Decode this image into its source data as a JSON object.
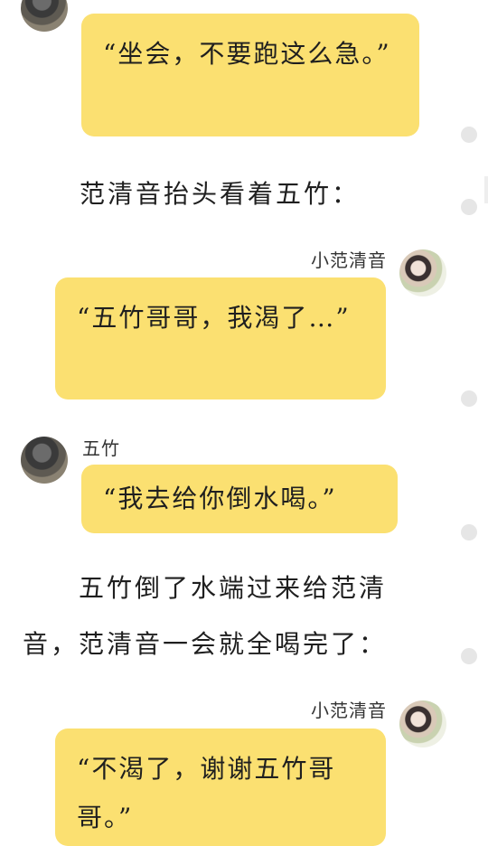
{
  "messages": [
    {
      "speaker": "",
      "text": "“坐会，不要跑这么急。”"
    },
    {
      "narration": "范清音抬头看着五竹："
    },
    {
      "speaker": "小范清音",
      "text": "“五竹哥哥，我渴了…”"
    },
    {
      "speaker": "五竹",
      "text": "“我去给你倒水喝。”"
    },
    {
      "narration": "五竹倒了水端过来给范清音，范清音一会就全喝完了："
    },
    {
      "speaker": "小范清音",
      "text": "“不渴了，谢谢五竹哥哥。”"
    }
  ]
}
